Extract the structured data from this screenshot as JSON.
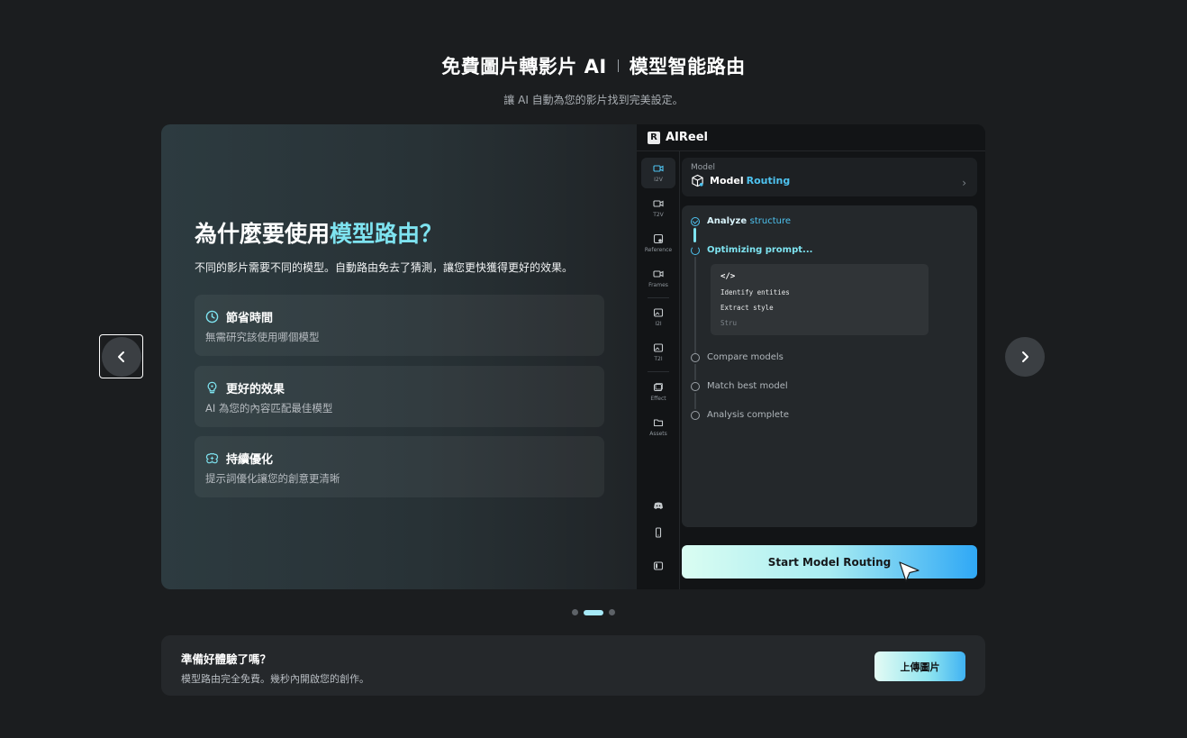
{
  "header": {
    "title_left": "免費圖片轉影片 AI",
    "title_right": "模型智能路由",
    "subtitle": "讓 AI 自動為您的影片找到完美設定。"
  },
  "slide": {
    "title_prefix": "為什麼要使用",
    "title_highlight": "模型路由？",
    "description": "不同的影片需要不同的模型。自動路由免去了猜測，讓您更快獲得更好的效果。",
    "features": [
      {
        "icon": "clock-icon",
        "title": "節省時間",
        "desc": "無需研究該使用哪個模型"
      },
      {
        "icon": "lightbulb-icon",
        "title": "更好的效果",
        "desc": "AI 為您的內容匹配最佳模型"
      },
      {
        "icon": "sparkle-brain-icon",
        "title": "持續優化",
        "desc": "提示詞優化讓您的創意更清晰"
      }
    ]
  },
  "app": {
    "name": "AIReel",
    "logo_letter": "R",
    "sidebar": [
      {
        "label": "I2V",
        "icon": "image-to-video-icon"
      },
      {
        "label": "T2V",
        "icon": "text-to-video-icon"
      },
      {
        "label": "Reference",
        "icon": "reference-icon"
      },
      {
        "label": "Frames",
        "icon": "frames-icon"
      },
      {
        "label": "I2I",
        "icon": "image-to-image-icon"
      },
      {
        "label": "T2I",
        "icon": "text-to-image-icon"
      },
      {
        "label": "Effect",
        "icon": "effect-icon"
      },
      {
        "label": "Assets",
        "icon": "folder-icon"
      }
    ],
    "model": {
      "label": "Model",
      "name_prefix": "Model",
      "name_highlight": "Routing"
    },
    "steps": [
      {
        "label": "Analyze",
        "highlight": "structure",
        "state": "done"
      },
      {
        "label": "Optimizing prompt...",
        "highlight": "",
        "state": "active"
      },
      {
        "label": "Compare models",
        "highlight": "",
        "state": "pending"
      },
      {
        "label": "Match best model",
        "highlight": "",
        "state": "pending"
      },
      {
        "label": "Analysis complete",
        "highlight": "",
        "state": "pending"
      }
    ],
    "code": {
      "icon": "</>",
      "lines": [
        "Identify entities",
        "Extract style",
        "Stru"
      ]
    },
    "start_button": "Start Model Routing"
  },
  "carousel": {
    "page_count": 3,
    "active_index": 1
  },
  "cta": {
    "title": "準備好體驗了嗎？",
    "subtitle": "模型路由完全免費。幾秒內開啟您的創作。",
    "button": "上傳圖片"
  },
  "colors": {
    "accent": "#4ec3f0",
    "background": "#1b1d1f"
  }
}
